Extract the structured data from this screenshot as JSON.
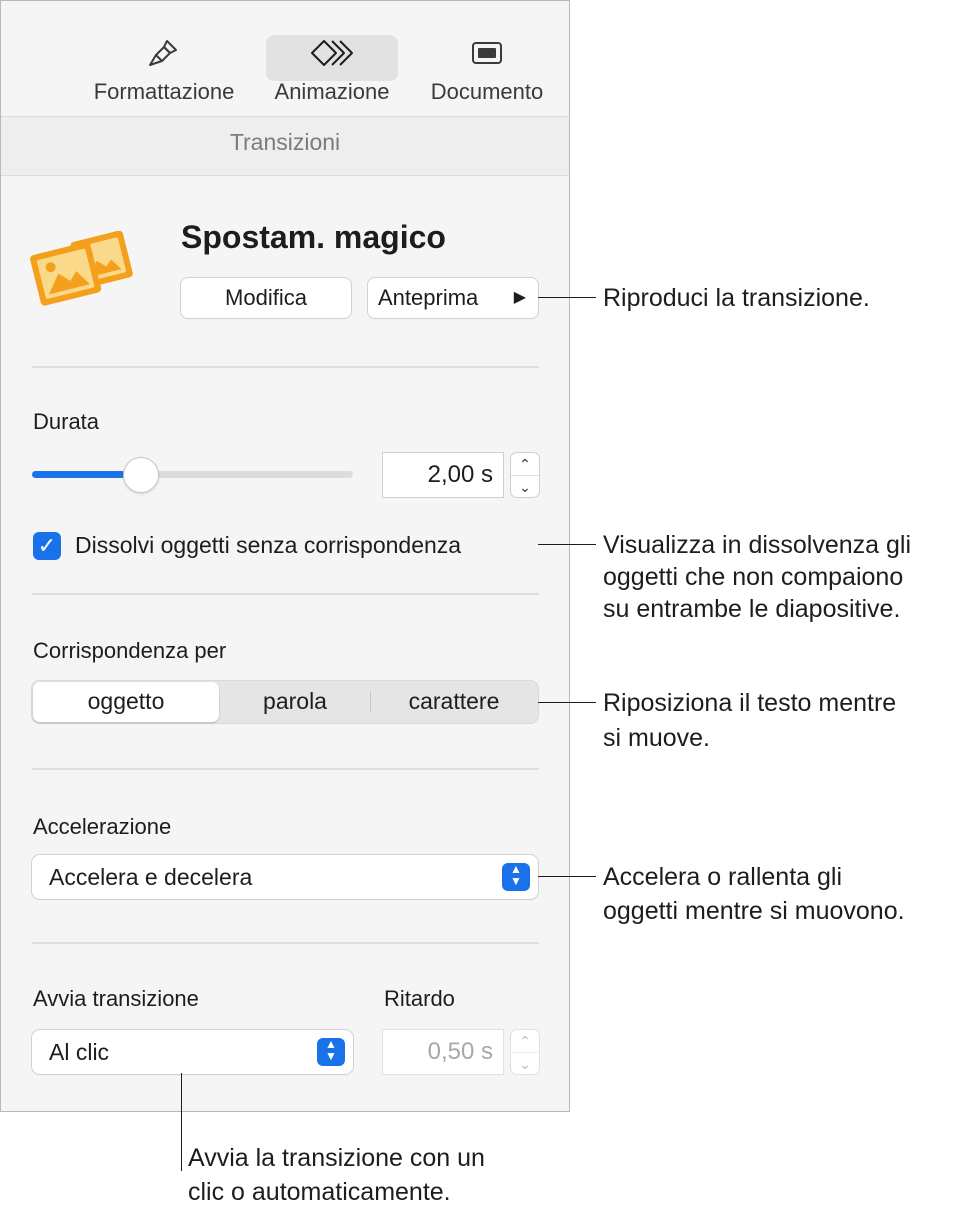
{
  "toolbar": {
    "format_label": "Formattazione",
    "animate_label": "Animazione",
    "document_label": "Documento"
  },
  "section": {
    "title": "Transizioni"
  },
  "transition": {
    "name": "Spostam. magico",
    "edit_label": "Modifica",
    "preview_label": "Anteprima"
  },
  "duration": {
    "label": "Durata",
    "value": "2,00 s",
    "slider_fraction": 0.29
  },
  "fade_option": {
    "checked": true,
    "label": "Dissolvi oggetti senza corrispondenza"
  },
  "match": {
    "label": "Corrispondenza per",
    "options": [
      "oggetto",
      "parola",
      "carattere"
    ],
    "selected": "oggetto"
  },
  "acceleration": {
    "label": "Accelerazione",
    "value": "Accelera e decelera"
  },
  "start": {
    "label": "Avvia transizione",
    "value": "Al clic",
    "delay_label": "Ritardo",
    "delay_value": "0,50 s"
  },
  "callouts": {
    "preview": "Riproduci la transizione.",
    "fade_1": "Visualizza in dissolvenza gli",
    "fade_2": "oggetti che non compaiono",
    "fade_3": "su entrambe le diapositive.",
    "match_1": "Riposiziona il testo mentre",
    "match_2": "si muove.",
    "accel_1": "Accelera o rallenta gli",
    "accel_2": "oggetti mentre si muovono.",
    "start_1": "Avvia la transizione con un",
    "start_2": "clic o automaticamente."
  },
  "colors": {
    "accent": "#1a72ea",
    "icon_orange": "#f4a01d"
  }
}
